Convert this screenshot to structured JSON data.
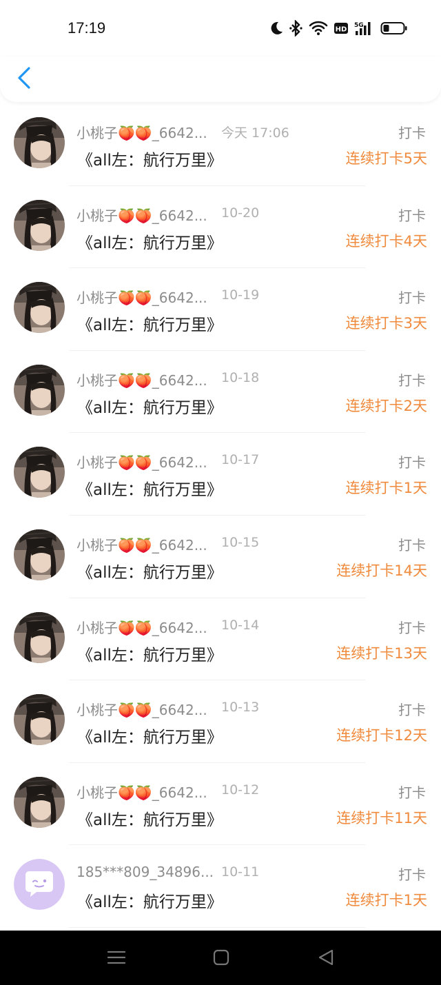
{
  "status_bar": {
    "time": "17:19",
    "icons": [
      "moon-icon",
      "bluetooth-icon",
      "wifi-icon",
      "hd-icon",
      "5g-signal-icon",
      "battery-icon"
    ]
  },
  "header": {
    "back_icon": "chevron-left-icon",
    "accent": "#2196f3"
  },
  "colors": {
    "streak": "#f08a3c",
    "meta": "#8c8c8c"
  },
  "entries": [
    {
      "name": "小桃子🍑🍑_6642...",
      "date": "今天 17:06",
      "title": "《all左：航行万里》",
      "tag": "打卡",
      "streak": "连续打卡5天",
      "avatar": "portrait"
    },
    {
      "name": "小桃子🍑🍑_6642...",
      "date": "10-20",
      "title": "《all左：航行万里》",
      "tag": "打卡",
      "streak": "连续打卡4天",
      "avatar": "portrait"
    },
    {
      "name": "小桃子🍑🍑_6642...",
      "date": "10-19",
      "title": "《all左：航行万里》",
      "tag": "打卡",
      "streak": "连续打卡3天",
      "avatar": "portrait"
    },
    {
      "name": "小桃子🍑🍑_6642...",
      "date": "10-18",
      "title": "《all左：航行万里》",
      "tag": "打卡",
      "streak": "连续打卡2天",
      "avatar": "portrait"
    },
    {
      "name": "小桃子🍑🍑_6642...",
      "date": "10-17",
      "title": "《all左：航行万里》",
      "tag": "打卡",
      "streak": "连续打卡1天",
      "avatar": "portrait"
    },
    {
      "name": "小桃子🍑🍑_6642...",
      "date": "10-15",
      "title": "《all左：航行万里》",
      "tag": "打卡",
      "streak": "连续打卡14天",
      "avatar": "portrait"
    },
    {
      "name": "小桃子🍑🍑_6642...",
      "date": "10-14",
      "title": "《all左：航行万里》",
      "tag": "打卡",
      "streak": "连续打卡13天",
      "avatar": "portrait"
    },
    {
      "name": "小桃子🍑🍑_6642...",
      "date": "10-13",
      "title": "《all左：航行万里》",
      "tag": "打卡",
      "streak": "连续打卡12天",
      "avatar": "portrait"
    },
    {
      "name": "小桃子🍑🍑_6642...",
      "date": "10-12",
      "title": "《all左：航行万里》",
      "tag": "打卡",
      "streak": "连续打卡11天",
      "avatar": "portrait"
    },
    {
      "name": "185***809_34896...",
      "date": "10-11",
      "title": "《all左：航行万里》",
      "tag": "打卡",
      "streak": "连续打卡1天",
      "avatar": "chat-bubble"
    }
  ],
  "nav_bar": {
    "icons": [
      "menu-icon",
      "home-icon",
      "back-triangle-icon"
    ]
  }
}
